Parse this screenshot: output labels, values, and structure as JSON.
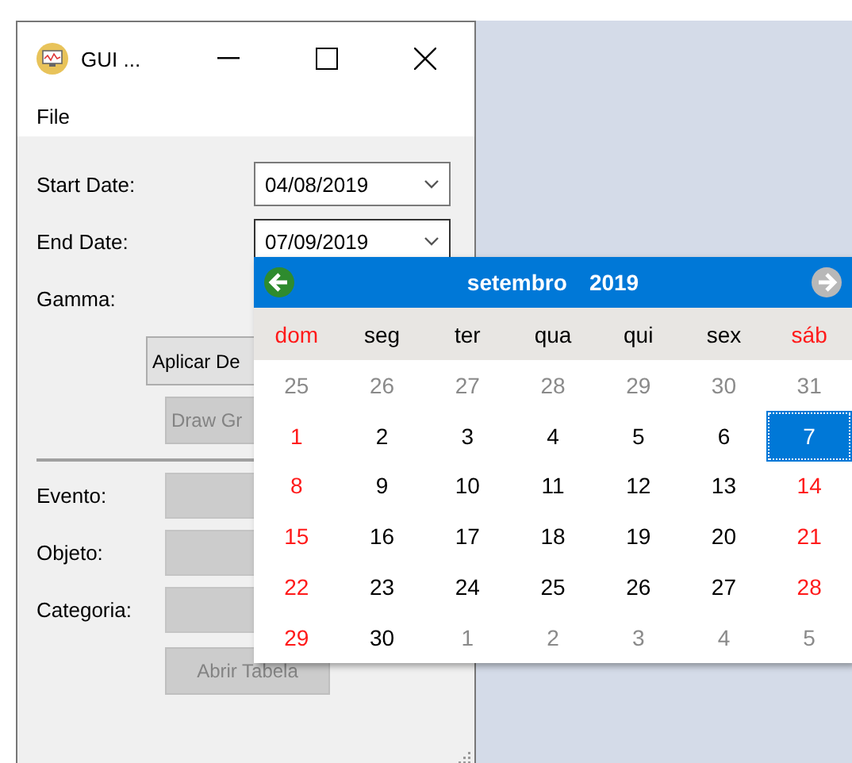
{
  "window": {
    "title": "GUI ..."
  },
  "menu": [
    "File"
  ],
  "form": {
    "fields": [
      {
        "label": "Start Date:",
        "kind": "date",
        "value": "04/08/2019",
        "open": false
      },
      {
        "label": "End Date:",
        "kind": "date",
        "value": "07/09/2019",
        "open": true
      },
      {
        "label": "Gamma:",
        "kind": "hidden"
      }
    ],
    "apply_button": {
      "label": "Aplicar De",
      "disabled": false
    },
    "draw_button": {
      "label": "Draw Gr",
      "disabled": true
    },
    "filters": [
      {
        "label": "Evento:",
        "disabled": true
      },
      {
        "label": "Objeto:",
        "disabled": true
      },
      {
        "label": "Categoria:",
        "disabled": true
      }
    ],
    "table_button": {
      "label": "Abrir Tabela",
      "disabled": true
    }
  },
  "calendar": {
    "month": "setembro",
    "year": "2019",
    "weekdays": [
      {
        "label": "dom",
        "kind": "weekend"
      },
      {
        "label": "seg",
        "kind": "weekday"
      },
      {
        "label": "ter",
        "kind": "weekday"
      },
      {
        "label": "qua",
        "kind": "weekday"
      },
      {
        "label": "qui",
        "kind": "weekday"
      },
      {
        "label": "sex",
        "kind": "weekday"
      },
      {
        "label": "sáb",
        "kind": "weekend"
      }
    ],
    "weeks": [
      [
        {
          "day": "25",
          "kind": "outside",
          "selected": false
        },
        {
          "day": "26",
          "kind": "outside",
          "selected": false
        },
        {
          "day": "27",
          "kind": "outside",
          "selected": false
        },
        {
          "day": "28",
          "kind": "outside",
          "selected": false
        },
        {
          "day": "29",
          "kind": "outside",
          "selected": false
        },
        {
          "day": "30",
          "kind": "outside",
          "selected": false
        },
        {
          "day": "31",
          "kind": "outside",
          "selected": false
        }
      ],
      [
        {
          "day": "1",
          "kind": "weekend",
          "selected": false
        },
        {
          "day": "2",
          "kind": "weekday",
          "selected": false
        },
        {
          "day": "3",
          "kind": "weekday",
          "selected": false
        },
        {
          "day": "4",
          "kind": "weekday",
          "selected": false
        },
        {
          "day": "5",
          "kind": "weekday",
          "selected": false
        },
        {
          "day": "6",
          "kind": "weekday",
          "selected": false
        },
        {
          "day": "7",
          "kind": "weekend",
          "selected": true
        }
      ],
      [
        {
          "day": "8",
          "kind": "weekend",
          "selected": false
        },
        {
          "day": "9",
          "kind": "weekday",
          "selected": false
        },
        {
          "day": "10",
          "kind": "weekday",
          "selected": false
        },
        {
          "day": "11",
          "kind": "weekday",
          "selected": false
        },
        {
          "day": "12",
          "kind": "weekday",
          "selected": false
        },
        {
          "day": "13",
          "kind": "weekday",
          "selected": false
        },
        {
          "day": "14",
          "kind": "weekend",
          "selected": false
        }
      ],
      [
        {
          "day": "15",
          "kind": "weekend",
          "selected": false
        },
        {
          "day": "16",
          "kind": "weekday",
          "selected": false
        },
        {
          "day": "17",
          "kind": "weekday",
          "selected": false
        },
        {
          "day": "18",
          "kind": "weekday",
          "selected": false
        },
        {
          "day": "19",
          "kind": "weekday",
          "selected": false
        },
        {
          "day": "20",
          "kind": "weekday",
          "selected": false
        },
        {
          "day": "21",
          "kind": "weekend",
          "selected": false
        }
      ],
      [
        {
          "day": "22",
          "kind": "weekend",
          "selected": false
        },
        {
          "day": "23",
          "kind": "weekday",
          "selected": false
        },
        {
          "day": "24",
          "kind": "weekday",
          "selected": false
        },
        {
          "day": "25",
          "kind": "weekday",
          "selected": false
        },
        {
          "day": "26",
          "kind": "weekday",
          "selected": false
        },
        {
          "day": "27",
          "kind": "weekday",
          "selected": false
        },
        {
          "day": "28",
          "kind": "weekend",
          "selected": false
        }
      ],
      [
        {
          "day": "29",
          "kind": "weekend",
          "selected": false
        },
        {
          "day": "30",
          "kind": "weekday",
          "selected": false
        },
        {
          "day": "1",
          "kind": "outside",
          "selected": false
        },
        {
          "day": "2",
          "kind": "outside",
          "selected": false
        },
        {
          "day": "3",
          "kind": "outside",
          "selected": false
        },
        {
          "day": "4",
          "kind": "outside",
          "selected": false
        },
        {
          "day": "5",
          "kind": "outside",
          "selected": false
        }
      ]
    ]
  }
}
